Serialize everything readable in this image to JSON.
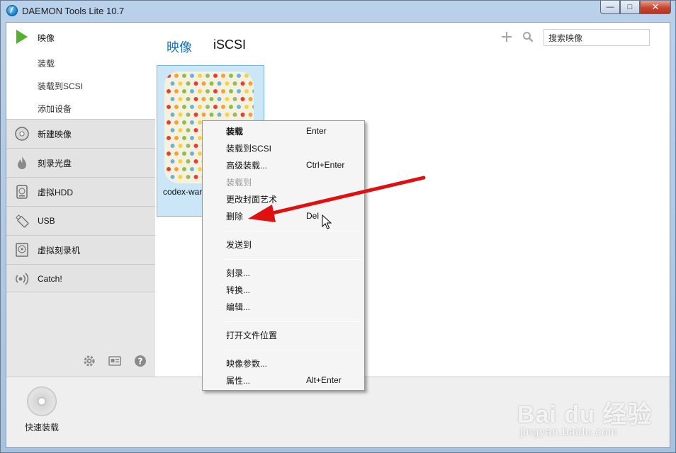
{
  "window": {
    "title": "DAEMON Tools Lite 10.7",
    "buttons": {
      "minimize": "—",
      "maximize": "□",
      "close": "✕"
    }
  },
  "sidebar": {
    "main_label": "映像",
    "sub_items": [
      "装载",
      "装载到SCSI",
      "添加设备"
    ],
    "items": [
      {
        "label": "新建映像",
        "icon": "disc-icon"
      },
      {
        "label": "刻录光盘",
        "icon": "flame-icon"
      },
      {
        "label": "虚拟HDD",
        "icon": "hdd-icon"
      },
      {
        "label": "USB",
        "icon": "usb-icon"
      },
      {
        "label": "虚拟刻录机",
        "icon": "burner-icon"
      },
      {
        "label": "Catch!",
        "icon": "catch-icon"
      }
    ],
    "footer_icons": [
      "gear-icon",
      "license-icon",
      "help-icon"
    ]
  },
  "main": {
    "tabs": [
      "映像",
      "iSCSI"
    ],
    "search": {
      "placeholder": "搜索映像"
    },
    "image_tile": {
      "label": "codex-war"
    }
  },
  "bottombar": {
    "quick_mount_label": "快速装载"
  },
  "context_menu": {
    "items": [
      {
        "label": "装载",
        "shortcut": "Enter",
        "bold": true
      },
      {
        "label": "装载到SCSI",
        "shortcut": ""
      },
      {
        "label": "高级装载...",
        "shortcut": "Ctrl+Enter"
      },
      {
        "label": "装载到",
        "shortcut": "",
        "disabled": true
      },
      {
        "label": "更改封面艺术",
        "shortcut": ""
      },
      {
        "label": "删除",
        "shortcut": "Del"
      },
      {
        "label": "发送到",
        "shortcut": ""
      },
      {
        "label": "刻录...",
        "shortcut": ""
      },
      {
        "label": "转换...",
        "shortcut": ""
      },
      {
        "label": "编辑...",
        "shortcut": ""
      },
      {
        "label": "打开文件位置",
        "shortcut": ""
      },
      {
        "label": "映像参数...",
        "shortcut": ""
      },
      {
        "label": "属性...",
        "shortcut": "Alt+Enter"
      }
    ]
  },
  "annotation": {
    "arrow_color": "#e01010"
  },
  "watermark": {
    "brand": "Bai du 经验",
    "url": "jingyan.baidu.com"
  },
  "colors": {
    "accent": "#1a73b8",
    "play": "#54b031",
    "selection": "#cbe6f7"
  }
}
